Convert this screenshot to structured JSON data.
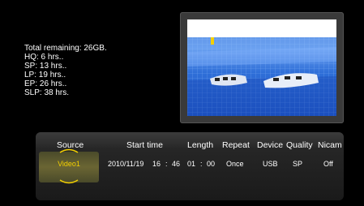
{
  "storage": {
    "total_remaining": "Total remaining: 26GB.",
    "hq": "HQ: 6 hrs..",
    "sp": "SP: 13 hrs..",
    "lp": "LP: 19 hrs..",
    "ep": "EP: 26 hrs..",
    "slp": "SLP: 38 hrs."
  },
  "schedule": {
    "headers": {
      "source": "Source",
      "start_time": "Start time",
      "length": "Length",
      "repeat": "Repeat",
      "device": "Device",
      "quality": "Quality",
      "nicam": "Nicam"
    },
    "row": {
      "source": "Video1",
      "start_date": "2010/11/19",
      "start_hour": "16",
      "start_sep": ":",
      "start_minute": "46",
      "length_hours": "01",
      "length_sep": ":",
      "length_minutes": "00",
      "repeat": "Once",
      "device": "USB",
      "quality": "SP",
      "nicam": "Off"
    }
  },
  "colors": {
    "selected_text": "#f4d000",
    "panel": "#262626"
  },
  "icons": {
    "up": "chevron-up-icon",
    "down": "chevron-down-icon"
  }
}
